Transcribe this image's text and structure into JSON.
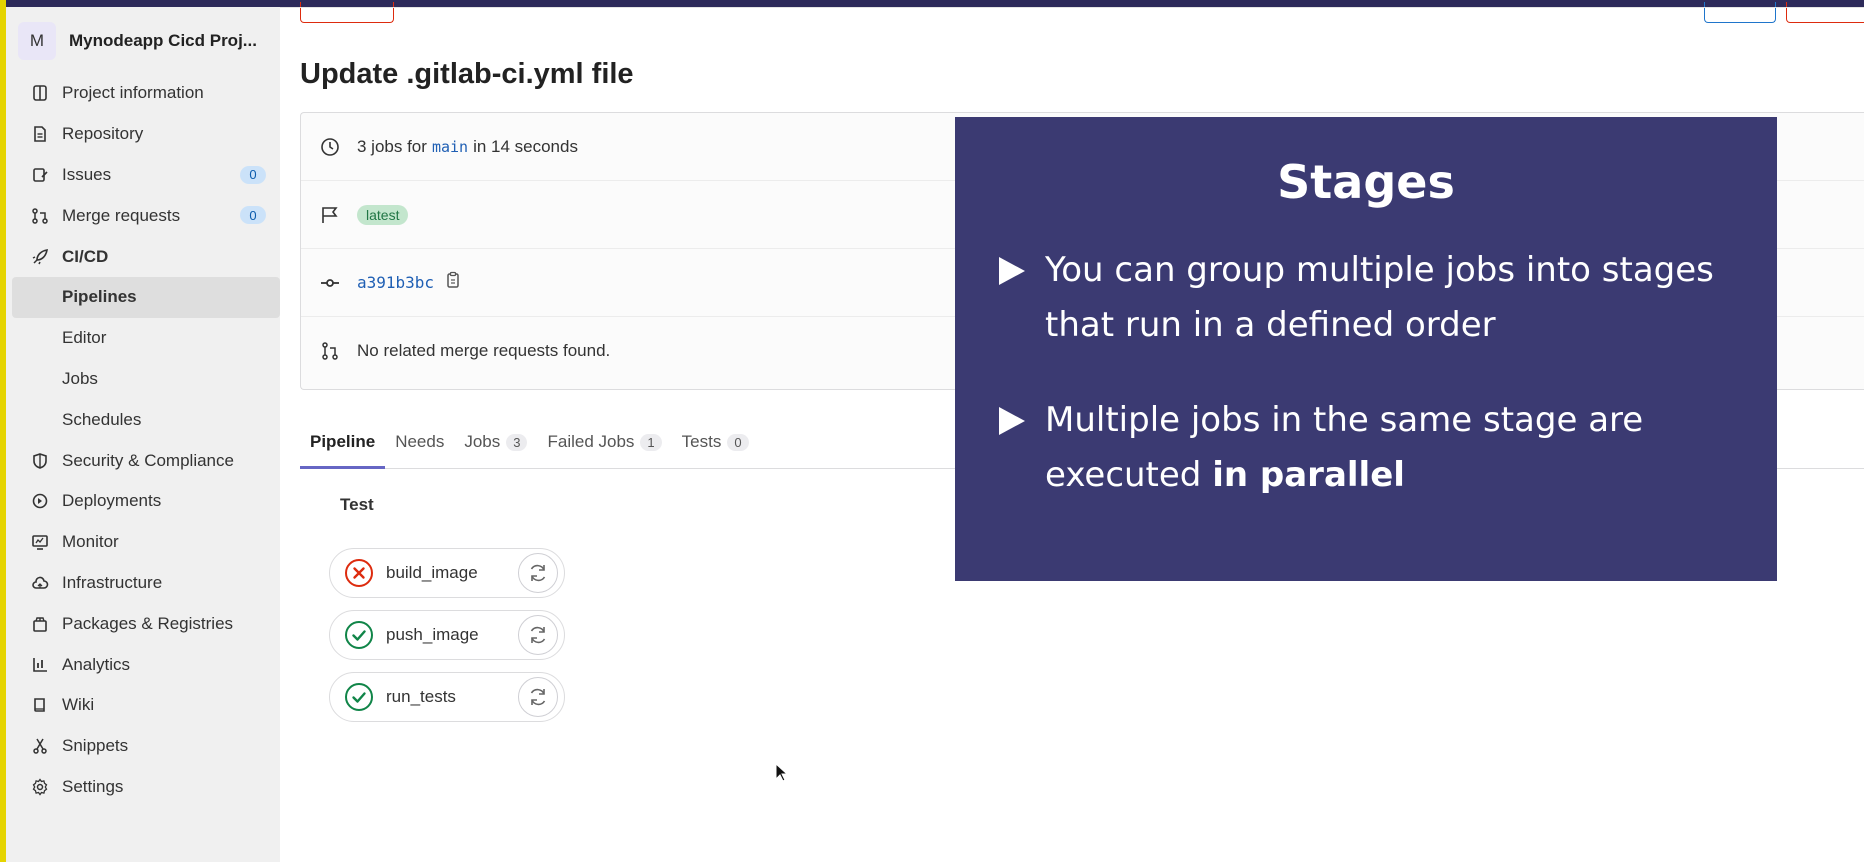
{
  "sidebar": {
    "project_initial": "M",
    "project_name": "Mynodeapp Cicd Proj...",
    "items": [
      {
        "label": "Project information",
        "icon": "project-info-icon"
      },
      {
        "label": "Repository",
        "icon": "document-icon"
      },
      {
        "label": "Issues",
        "icon": "issues-icon",
        "count": "0"
      },
      {
        "label": "Merge requests",
        "icon": "merge-request-icon",
        "count": "0"
      },
      {
        "label": "CI/CD",
        "icon": "rocket-icon"
      },
      {
        "label": "Pipelines"
      },
      {
        "label": "Editor"
      },
      {
        "label": "Jobs"
      },
      {
        "label": "Schedules"
      },
      {
        "label": "Security & Compliance",
        "icon": "shield-icon"
      },
      {
        "label": "Deployments",
        "icon": "deployments-icon"
      },
      {
        "label": "Monitor",
        "icon": "monitor-icon"
      },
      {
        "label": "Infrastructure",
        "icon": "cloud-icon"
      },
      {
        "label": "Packages & Registries",
        "icon": "package-icon"
      },
      {
        "label": "Analytics",
        "icon": "chart-icon"
      },
      {
        "label": "Wiki",
        "icon": "book-icon"
      },
      {
        "label": "Snippets",
        "icon": "scissors-icon"
      },
      {
        "label": "Settings",
        "icon": "gear-icon"
      }
    ]
  },
  "page": {
    "title": "Update .gitlab-ci.yml file"
  },
  "info": {
    "jobs_prefix": "3 jobs for",
    "branch": "main",
    "jobs_suffix": "in 14 seconds",
    "tag": "latest",
    "commit_sha": "a391b3bc",
    "merge_requests": "No related merge requests found."
  },
  "tabs": [
    {
      "label": "Pipeline"
    },
    {
      "label": "Needs"
    },
    {
      "label": "Jobs",
      "count": "3"
    },
    {
      "label": "Failed Jobs",
      "count": "1"
    },
    {
      "label": "Tests",
      "count": "0"
    }
  ],
  "stage": {
    "name": "Test",
    "jobs": [
      {
        "name": "build_image",
        "status": "failed"
      },
      {
        "name": "push_image",
        "status": "passed"
      },
      {
        "name": "run_tests",
        "status": "passed"
      }
    ]
  },
  "slide": {
    "title": "Stages",
    "bullet1": "You can group multiple jobs into stages that run in a defined order",
    "bullet2_prefix": "Multiple jobs in the same stage are executed",
    "bullet2_bold": "in parallel"
  },
  "colors": {
    "failed": "#dd2b0e",
    "passed": "#108548",
    "slide_bg": "#3b3a72",
    "accent": "#6666c4"
  }
}
